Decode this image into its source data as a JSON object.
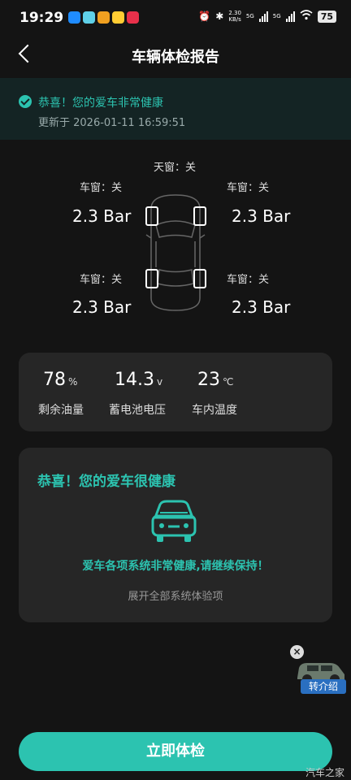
{
  "status_bar": {
    "time": "19:29",
    "net_speed_top": "2.30",
    "net_speed_unit": "KB/s",
    "sim1": "5G",
    "sim2": "5G",
    "battery": "75"
  },
  "header": {
    "title": "车辆体检报告"
  },
  "banner": {
    "message": "恭喜！您的爱车非常健康",
    "updated": "更新于 2026-01-11 16:59:51"
  },
  "tires": {
    "sunroof": "天窗：关",
    "front_left": {
      "window": "车窗：关",
      "pressure": "2.3 Bar"
    },
    "front_right": {
      "window": "车窗：关",
      "pressure": "2.3 Bar"
    },
    "rear_left": {
      "window": "车窗：关",
      "pressure": "2.3 Bar"
    },
    "rear_right": {
      "window": "车窗：关",
      "pressure": "2.3 Bar"
    }
  },
  "stats": [
    {
      "value": "78",
      "unit": "%",
      "label": "剩余油量"
    },
    {
      "value": "14.3",
      "unit": "v",
      "label": "蓄电池电压"
    },
    {
      "value": "23",
      "unit": "℃",
      "label": "车内温度"
    }
  ],
  "health": {
    "title": "恭喜！您的爱车很健康",
    "message": "爱车各项系统非常健康,请继续保持！",
    "expand": "展开全部系统体验项"
  },
  "ad": {
    "label": "转介绍"
  },
  "action_button": "立即体检",
  "watermark": "汽车之家",
  "colors": {
    "accent": "#2cc3b0",
    "background": "#141414",
    "card": "#262626"
  }
}
